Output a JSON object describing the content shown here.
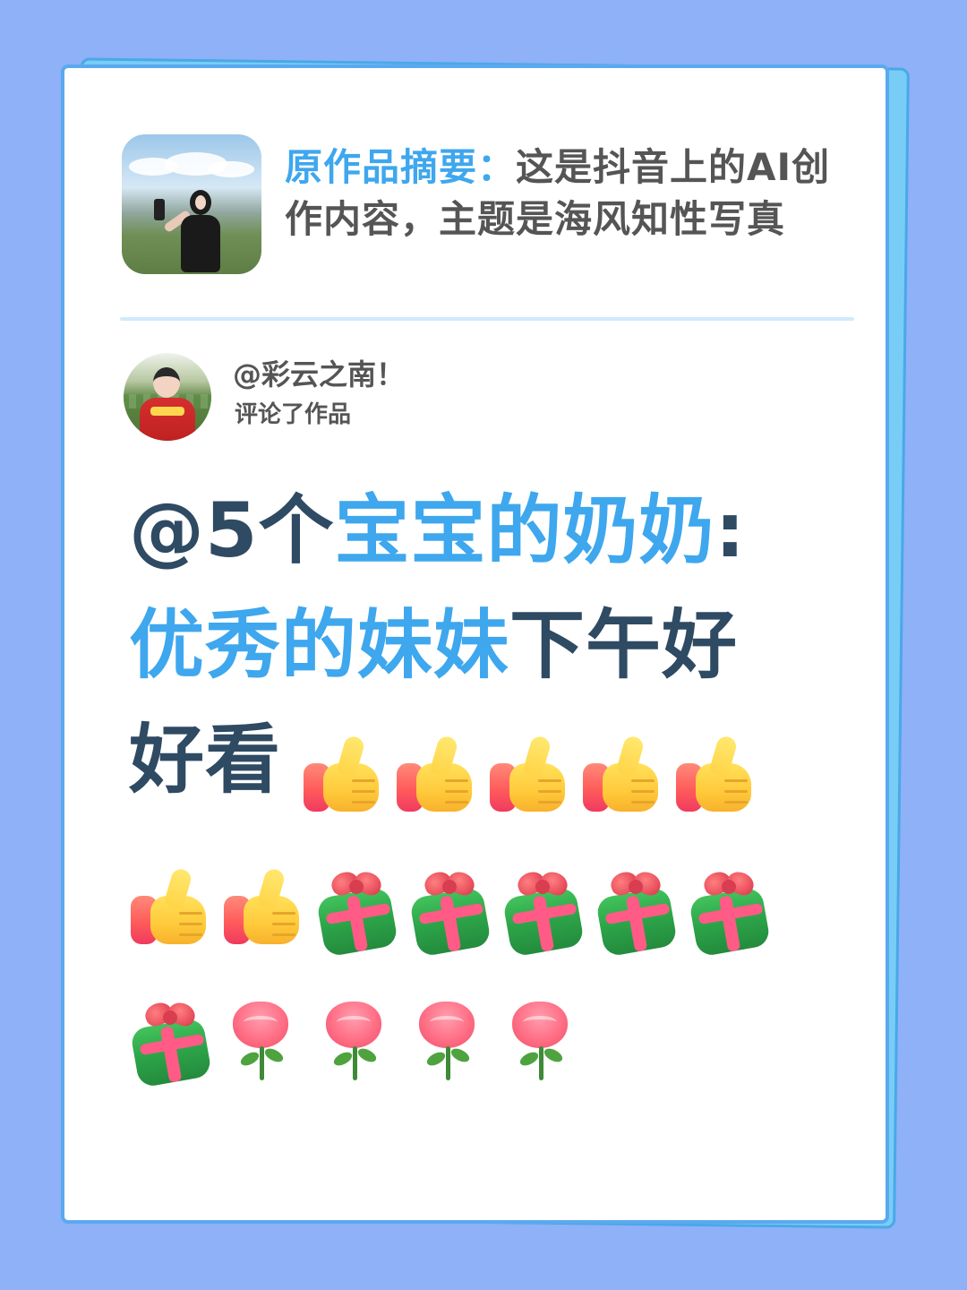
{
  "summary": {
    "label": "原作品摘要：",
    "text": "这是抖音上的AI创作内容，主题是海风知性写真"
  },
  "commenter": {
    "name": "@彩云之南！",
    "action": "评论了作品"
  },
  "comment": {
    "prefix": "@5个",
    "name_highlight": "宝宝的奶奶",
    "colon": ":",
    "greeting_highlight": "优秀的妹妹",
    "greeting_rest": "下午好",
    "praise": "好看"
  },
  "emojis": {
    "row1": [
      "thumbs-up",
      "thumbs-up",
      "thumbs-up",
      "thumbs-up",
      "thumbs-up"
    ],
    "row2": [
      "thumbs-up",
      "thumbs-up",
      "gift",
      "gift",
      "gift",
      "gift",
      "gift"
    ],
    "row3": [
      "gift",
      "rose",
      "rose",
      "rose",
      "rose"
    ]
  },
  "colors": {
    "background": "#8eb1f7",
    "accent_blue": "#3ea7ee",
    "text_dark": "#2f4a63",
    "text_gray": "#555555"
  }
}
